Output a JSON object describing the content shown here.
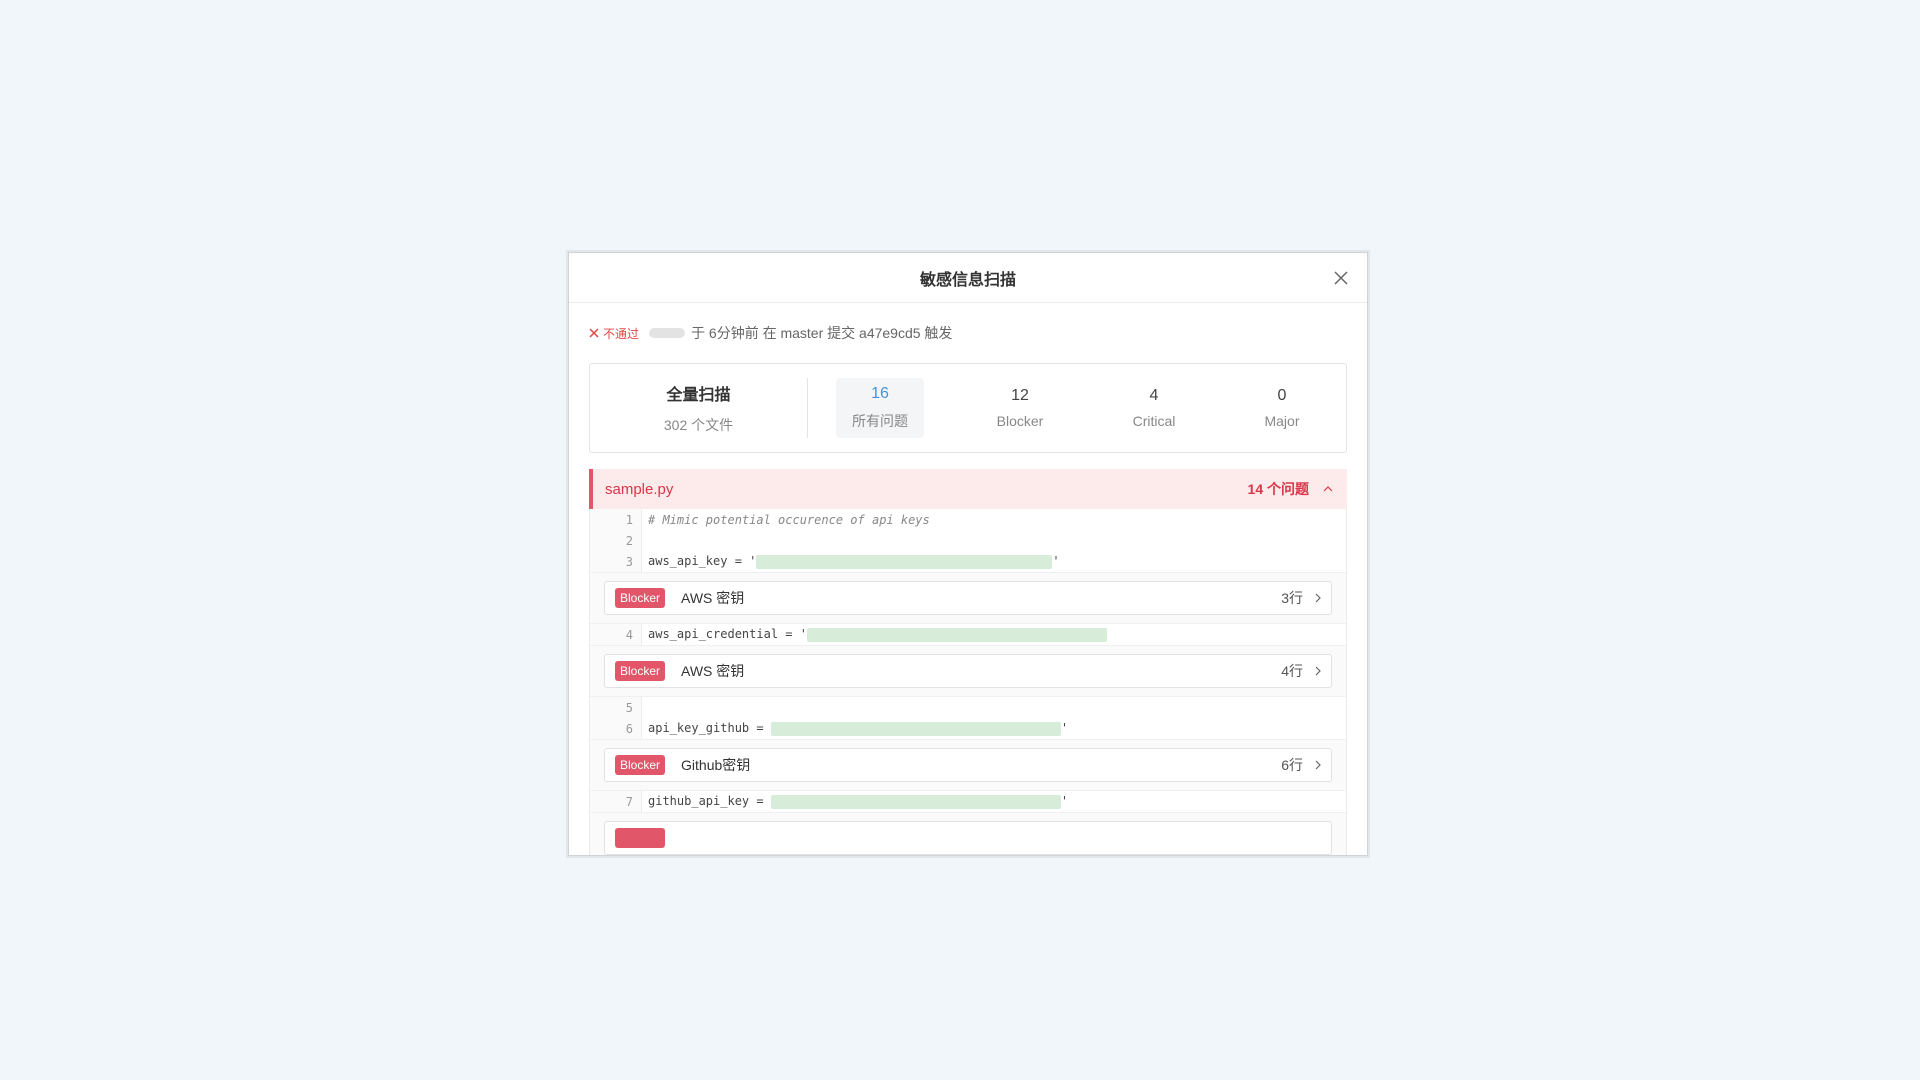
{
  "modal": {
    "title": "敏感信息扫描"
  },
  "status": {
    "badge": "不通过",
    "text": "于 6分钟前 在 master 提交 a47e9cd5 触发"
  },
  "summary": {
    "title": "全量扫描",
    "files": "302 个文件",
    "stats": [
      {
        "num": "16",
        "label": "所有问题"
      },
      {
        "num": "12",
        "label": "Blocker"
      },
      {
        "num": "4",
        "label": "Critical"
      },
      {
        "num": "0",
        "label": "Major"
      }
    ]
  },
  "file": {
    "name": "sample.py",
    "count": "14 个问题"
  },
  "lines": [
    {
      "n": "1",
      "code": "# Mimic potential occurence of api keys"
    },
    {
      "n": "2",
      "code": ""
    },
    {
      "n": "3",
      "code": "aws_api_key = '"
    },
    {
      "n": "4",
      "code": "aws_api_credential = '"
    },
    {
      "n": "5",
      "code": ""
    },
    {
      "n": "6",
      "code": "api_key_github = "
    },
    {
      "n": "7",
      "code": "github_api_key = "
    }
  ],
  "issues": [
    {
      "tag": "Blocker",
      "name": "AWS 密钥",
      "line": "3行"
    },
    {
      "tag": "Blocker",
      "name": "AWS 密钥",
      "line": "4行"
    },
    {
      "tag": "Blocker",
      "name": "Github密钥",
      "line": "6行"
    }
  ]
}
